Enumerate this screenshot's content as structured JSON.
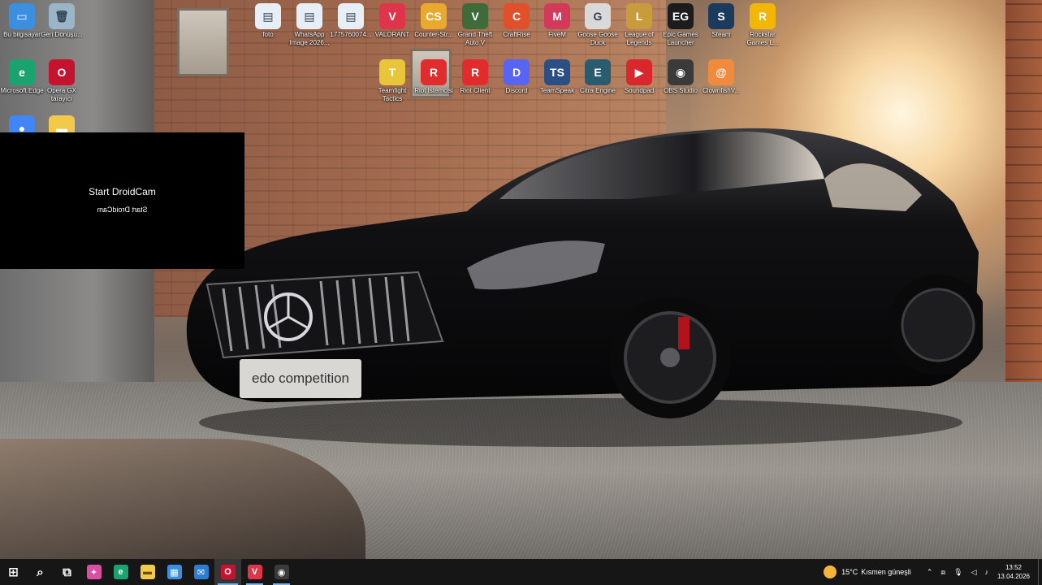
{
  "desktop": {
    "icons": [
      {
        "label": "Bu bilgisayar",
        "icon": "computer-icon",
        "color": "#3b8fe0"
      },
      {
        "label": "Geri Dönüşü...",
        "icon": "recycle-bin-icon",
        "color": "#9ab4c8"
      },
      {
        "label": "foto",
        "icon": "image-file-icon",
        "color": "#e8eef6"
      },
      {
        "label": "WhatsApp Image 2026...",
        "icon": "image-file-icon",
        "color": "#e8eef6"
      },
      {
        "label": "1775760074...",
        "icon": "image-file-icon",
        "color": "#e8eef6"
      },
      {
        "label": "VALORANT",
        "icon": "valorant-icon",
        "color": "#e0344a"
      },
      {
        "label": "Counter-Str...",
        "icon": "counter-strike-icon",
        "color": "#e8a92e"
      },
      {
        "label": "Grand Theft Auto V",
        "icon": "gta-icon",
        "color": "#3f6b3a"
      },
      {
        "label": "CraftRise",
        "icon": "craftrise-icon",
        "color": "#e0502a"
      },
      {
        "label": "FiveM",
        "icon": "fivem-icon",
        "color": "#d33a5a"
      },
      {
        "label": "Goose Goose Duck",
        "icon": "goose-icon",
        "color": "#d9d9d9"
      },
      {
        "label": "League of Legends",
        "icon": "league-icon",
        "color": "#c89b3c"
      },
      {
        "label": "Epic Games Launcher",
        "icon": "epic-games-icon",
        "color": "#1c1c1c"
      },
      {
        "label": "Steam",
        "icon": "steam-icon",
        "color": "#1b3a5c"
      },
      {
        "label": "Rockstar Games L...",
        "icon": "rockstar-icon",
        "color": "#f2b705"
      },
      {
        "label": "Microsoft Edge",
        "icon": "edge-icon",
        "color": "#1aa36f"
      },
      {
        "label": "Opera GX tarayıcı",
        "icon": "opera-gx-icon",
        "color": "#c5122f"
      },
      {
        "label": "Teamfight Tactics",
        "icon": "tft-icon",
        "color": "#e8c53a"
      },
      {
        "label": "Riot İstemcisi",
        "icon": "riot-icon",
        "color": "#e02c2c"
      },
      {
        "label": "Riot Client",
        "icon": "riot-icon",
        "color": "#e02c2c"
      },
      {
        "label": "Discord",
        "icon": "discord-icon",
        "color": "#5865f2"
      },
      {
        "label": "TeamSpeak",
        "icon": "teamspeak-icon",
        "color": "#2b4f84"
      },
      {
        "label": "Citra Engine",
        "icon": "engine-icon",
        "color": "#2a5b6e"
      },
      {
        "label": "Soundpad",
        "icon": "soundpad-icon",
        "color": "#d8282e"
      },
      {
        "label": "OBS Studio",
        "icon": "obs-icon",
        "color": "#3a3a3a"
      },
      {
        "label": "ClownfishV...",
        "icon": "clownfish-icon",
        "color": "#f08a3c"
      },
      {
        "label": "",
        "icon": "chrome-icon",
        "color": "#4285f4"
      },
      {
        "label": "",
        "icon": "folder-icon",
        "color": "#f3c94b"
      }
    ]
  },
  "droidcam": {
    "title": "Start DroidCam",
    "mirror": "Start DroidCam"
  },
  "wallpaper": {
    "plate_text": "edo competition"
  },
  "taskbar": {
    "buttons": [
      {
        "name": "start-button",
        "icon": "windows-icon",
        "color": "#ffffff",
        "glyph": "⊞"
      },
      {
        "name": "search-button",
        "icon": "search-icon",
        "color": "#ffffff",
        "glyph": "⌕"
      },
      {
        "name": "task-view-button",
        "icon": "task-view-icon",
        "color": "#ffffff",
        "glyph": "⧉"
      },
      {
        "name": "copilot-button",
        "icon": "copilot-icon",
        "color": "#d94fa3",
        "glyph": "✦"
      },
      {
        "name": "edge-taskbar-button",
        "icon": "edge-icon",
        "color": "#1aa36f",
        "glyph": "e"
      },
      {
        "name": "file-explorer-button",
        "icon": "folder-icon",
        "color": "#f3c94b",
        "glyph": "▬"
      },
      {
        "name": "store-button",
        "icon": "store-icon",
        "color": "#3b8fe0",
        "glyph": "▦"
      },
      {
        "name": "outlook-button",
        "icon": "mail-icon",
        "color": "#2b7cd3",
        "glyph": "✉"
      },
      {
        "name": "opera-gx-taskbar-button",
        "icon": "opera-gx-icon",
        "color": "#c5122f",
        "glyph": "O"
      },
      {
        "name": "valorant-taskbar-button",
        "icon": "valorant-icon",
        "color": "#e0344a",
        "glyph": "V"
      },
      {
        "name": "obs-taskbar-button",
        "icon": "obs-icon",
        "color": "#3a3a3a",
        "glyph": "◉"
      }
    ],
    "weather": {
      "temp": "15°C",
      "desc": "Kısmen güneşli",
      "icon": "sun-cloud-icon"
    },
    "tray_icons": [
      "chevron-up-icon",
      "network-icon",
      "microphone-icon",
      "volume-icon",
      "speaker-icon"
    ],
    "time": "13:52",
    "date": "13.04.2026"
  }
}
